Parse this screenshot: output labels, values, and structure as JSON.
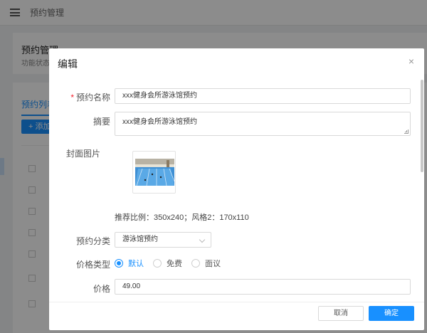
{
  "topbar": {
    "breadcrumb": "预约管理"
  },
  "background": {
    "card_title": "预约管理",
    "card_subtitle": "功能状态：",
    "tab_label": "预约列表",
    "add_button": "+ 添加"
  },
  "modal": {
    "title": "编辑",
    "close_glyph": "×",
    "fields": {
      "name_label": "预约名称",
      "name_value": "xxx健身会所游泳馆预约",
      "summary_label": "摘要",
      "summary_value": "xxx健身会所游泳馆预约",
      "cover_label": "封面图片",
      "cover_hint": "推荐比例：350x240；风格2：170x110",
      "category_label": "预约分类",
      "category_value": "游泳馆预约",
      "price_type_label": "价格类型",
      "price_type_options": [
        "默认",
        "免费",
        "面议"
      ],
      "price_type_selected": "默认",
      "price_label": "价格",
      "price_value": "49.00"
    },
    "footer": {
      "cancel": "取消",
      "ok": "确定"
    }
  },
  "colors": {
    "primary": "#1890ff",
    "required": "#f5222d",
    "overlay": "rgba(0,0,0,0.45)"
  }
}
